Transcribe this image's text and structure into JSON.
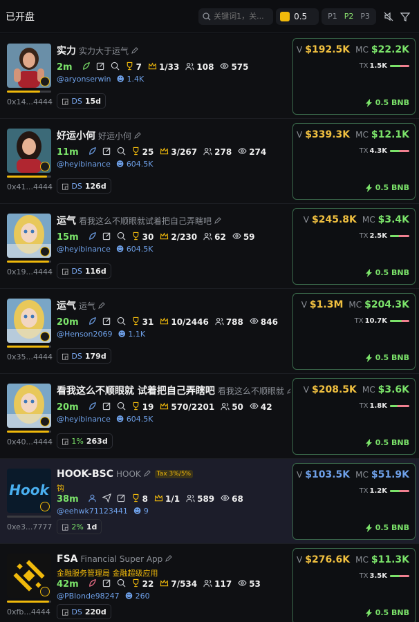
{
  "header": {
    "title": "已开盘",
    "search_placeholder": "关键词1，关...",
    "amount": "0.5",
    "presets": [
      "P1",
      "P2",
      "P3"
    ],
    "active_preset": "P2"
  },
  "rows": [
    {
      "name": "实力",
      "subtitle": "实力大于运气",
      "age": "2m",
      "trophies": "7",
      "crowns": "1/33",
      "holders": "108",
      "views": "575",
      "handle": "@aryonserwin",
      "followers": "1.4K",
      "address": "0x14...4444",
      "pill_label": "DS",
      "pill_value": "15d",
      "volume": "$192.5K",
      "mcap": "$22.2K",
      "tx": "1.5K",
      "buy": "0.5 BNB",
      "progress": 0.75,
      "tx_buy_ratio": 0.55
    },
    {
      "name": "好运小何",
      "subtitle": "好运小何",
      "age": "11m",
      "trophies": "25",
      "crowns": "3/267",
      "holders": "278",
      "views": "274",
      "handle": "@heyibinance",
      "followers": "604.5K",
      "address": "0x41...4444",
      "pill_label": "DS",
      "pill_value": "126d",
      "volume": "$339.3K",
      "mcap": "$12.1K",
      "tx": "4.3K",
      "buy": "0.5 BNB",
      "progress": 0.9,
      "tx_buy_ratio": 0.5
    },
    {
      "name": "运气",
      "subtitle": "看我这么不顺眼就试着把自己弄瞎吧",
      "age": "15m",
      "trophies": "30",
      "crowns": "2/230",
      "holders": "62",
      "views": "59",
      "handle": "@heyibinance",
      "followers": "604.5K",
      "address": "0x19...4444",
      "pill_label": "DS",
      "pill_value": "116d",
      "volume": "$245.8K",
      "mcap": "$3.4K",
      "tx": "2.5K",
      "buy": "0.5 BNB",
      "progress": 0.95,
      "tx_buy_ratio": 0.45
    },
    {
      "name": "运气",
      "subtitle": "运气",
      "age": "20m",
      "trophies": "31",
      "crowns": "10/2446",
      "holders": "788",
      "views": "846",
      "handle": "@Henson2069",
      "followers": "1.1K",
      "address": "0x35...4444",
      "pill_label": "DS",
      "pill_value": "179d",
      "volume": "$1.3M",
      "mcap": "$204.3K",
      "tx": "10.7K",
      "buy": "0.5 BNB",
      "progress": 0.95,
      "tx_buy_ratio": 0.6
    },
    {
      "name": "看我这么不顺眼就 试着把自己弄瞎吧",
      "subtitle": "看我这么不顺眼就",
      "age": "20m",
      "trophies": "19",
      "crowns": "570/2201",
      "holders": "50",
      "views": "42",
      "handle": "@heyibinance",
      "followers": "604.5K",
      "address": "0x40...4444",
      "pill_label": "1%",
      "pill_value": "263d",
      "volume": "$208.5K",
      "mcap": "$3.6K",
      "tx": "1.8K",
      "buy": "0.5 BNB",
      "progress": 0.95,
      "tx_buy_ratio": 0.4
    },
    {
      "name": "HOOK-BSC",
      "subtitle": "HOOK",
      "tax": "Tax 3%/5%",
      "subline2": "钩",
      "age": "38m",
      "trophies": "8",
      "crowns": "1/1",
      "holders": "589",
      "views": "68",
      "handle": "@eehwk71123441",
      "followers": "9",
      "address": "0xe3...7777",
      "pill_label": "2%",
      "pill_value": "1d",
      "volume": "$103.5K",
      "mcap": "$51.9K",
      "tx": "1.2K",
      "buy": "0.5 BNB",
      "progress": 0,
      "tx_buy_ratio": 0.5
    },
    {
      "name": "FSA",
      "subtitle": "Financial Super App",
      "subline2": "金融服务管理局 金融超级应用",
      "age": "42m",
      "trophies": "22",
      "crowns": "7/534",
      "holders": "117",
      "views": "53",
      "handle": "@PBlonde98247",
      "followers": "260",
      "address": "0xfb...4444",
      "pill_label": "DS",
      "pill_value": "220d",
      "volume": "$276.6K",
      "mcap": "$11.3K",
      "tx": "3.5K",
      "buy": "0.5 BNB",
      "progress": 0.95,
      "tx_buy_ratio": 0.5
    }
  ]
}
